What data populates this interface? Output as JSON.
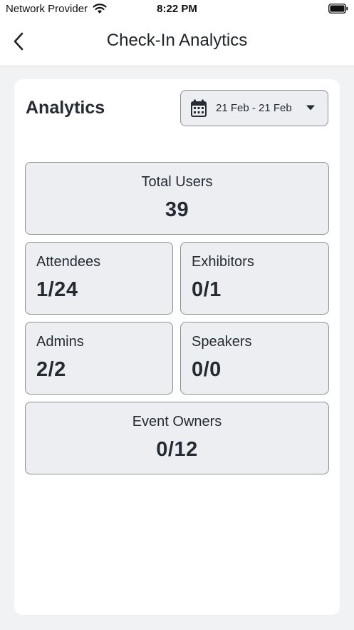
{
  "status_bar": {
    "carrier": "Network Provider",
    "time": "8:22 PM",
    "wifi_icon": "wifi-icon",
    "battery_icon": "battery-icon"
  },
  "nav": {
    "title": "Check-In Analytics",
    "back_icon": "chevron-left-icon"
  },
  "analytics": {
    "title": "Analytics",
    "date_range": {
      "label": "21 Feb - 21 Feb",
      "icon": "calendar-icon",
      "dropdown_icon": "caret-down-icon"
    },
    "stats": {
      "total_users": {
        "label": "Total Users",
        "value": "39"
      },
      "attendees": {
        "label": "Attendees",
        "value": "1/24"
      },
      "exhibitors": {
        "label": "Exhibitors",
        "value": "0/1"
      },
      "admins": {
        "label": "Admins",
        "value": "2/2"
      },
      "speakers": {
        "label": "Speakers",
        "value": "0/0"
      },
      "event_owners": {
        "label": "Event Owners",
        "value": "0/12"
      }
    }
  },
  "colors": {
    "background": "#f1f2f4",
    "card": "#ffffff",
    "stat_fill": "#eceef1",
    "stat_border": "#8e9196",
    "text": "#262b33"
  }
}
